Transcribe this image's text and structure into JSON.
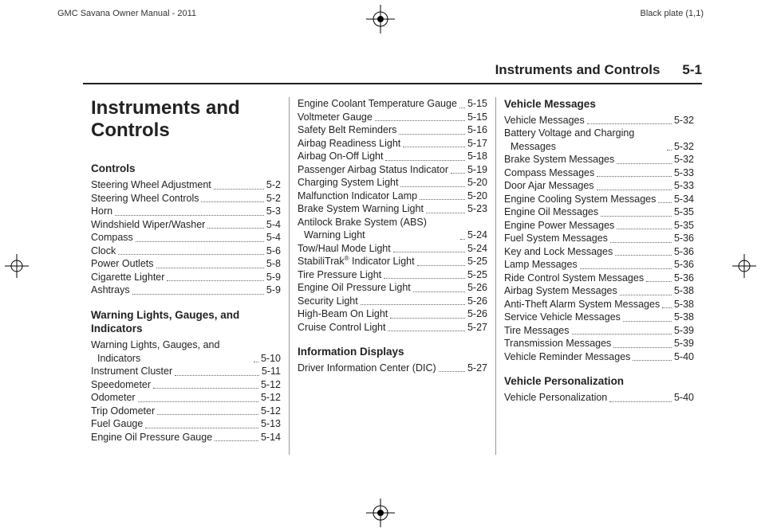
{
  "header": {
    "left": "GMC Savana Owner Manual - 2011",
    "right": "Black plate (1,1)"
  },
  "runningHead": {
    "title": "Instruments and Controls",
    "pageNo": "5-1"
  },
  "chapterTitle": "Instruments and Controls",
  "sections": {
    "controls": {
      "heading": "Controls",
      "items": [
        {
          "label": "Steering Wheel Adjustment",
          "page": "5-2"
        },
        {
          "label": "Steering Wheel Controls",
          "page": "5-2"
        },
        {
          "label": "Horn",
          "page": "5-3"
        },
        {
          "label": "Windshield Wiper/Washer",
          "page": "5-4"
        },
        {
          "label": "Compass",
          "page": "5-4"
        },
        {
          "label": "Clock",
          "page": "5-6"
        },
        {
          "label": "Power Outlets",
          "page": "5-8"
        },
        {
          "label": "Cigarette Lighter",
          "page": "5-9"
        },
        {
          "label": "Ashtrays",
          "page": "5-9"
        }
      ]
    },
    "warning": {
      "heading": "Warning Lights, Gauges, and Indicators",
      "items": [
        {
          "label": "Warning Lights, Gauges, and Indicators",
          "page": "5-10"
        },
        {
          "label": "Instrument Cluster",
          "page": "5-11"
        },
        {
          "label": "Speedometer",
          "page": "5-12"
        },
        {
          "label": "Odometer",
          "page": "5-12"
        },
        {
          "label": "Trip Odometer",
          "page": "5-12"
        },
        {
          "label": "Fuel Gauge",
          "page": "5-13"
        },
        {
          "label": "Engine Oil Pressure Gauge",
          "page": "5-14"
        },
        {
          "label": "Engine Coolant Temperature Gauge",
          "page": "5-15"
        },
        {
          "label": "Voltmeter Gauge",
          "page": "5-15"
        },
        {
          "label": "Safety Belt Reminders",
          "page": "5-16"
        },
        {
          "label": "Airbag Readiness Light",
          "page": "5-17"
        },
        {
          "label": "Airbag On-Off Light",
          "page": "5-18"
        },
        {
          "label": "Passenger Airbag Status Indicator",
          "page": "5-19"
        },
        {
          "label": "Charging System Light",
          "page": "5-20"
        },
        {
          "label": "Malfunction Indicator Lamp",
          "page": "5-20"
        },
        {
          "label": "Brake System Warning Light",
          "page": "5-23"
        },
        {
          "label": "Antilock Brake System (ABS) Warning Light",
          "page": "5-24"
        },
        {
          "label": "Tow/Haul Mode Light",
          "page": "5-24"
        },
        {
          "label": "StabiliTrak® Indicator Light",
          "page": "5-25",
          "reg": true
        },
        {
          "label": "Tire Pressure Light",
          "page": "5-25"
        },
        {
          "label": "Engine Oil Pressure Light",
          "page": "5-26"
        },
        {
          "label": "Security Light",
          "page": "5-26"
        },
        {
          "label": "High-Beam On Light",
          "page": "5-26"
        },
        {
          "label": "Cruise Control Light",
          "page": "5-27"
        }
      ]
    },
    "info": {
      "heading": "Information Displays",
      "items": [
        {
          "label": "Driver Information Center (DIC)",
          "page": "5-27"
        }
      ]
    },
    "vmsg": {
      "heading": "Vehicle Messages",
      "items": [
        {
          "label": "Vehicle Messages",
          "page": "5-32"
        },
        {
          "label": "Battery Voltage and Charging Messages",
          "page": "5-32"
        },
        {
          "label": "Brake System Messages",
          "page": "5-32"
        },
        {
          "label": "Compass Messages",
          "page": "5-33"
        },
        {
          "label": "Door Ajar Messages",
          "page": "5-33"
        },
        {
          "label": "Engine Cooling System Messages",
          "page": "5-34"
        },
        {
          "label": "Engine Oil Messages",
          "page": "5-35"
        },
        {
          "label": "Engine Power Messages",
          "page": "5-35"
        },
        {
          "label": "Fuel System Messages",
          "page": "5-36"
        },
        {
          "label": "Key and Lock Messages",
          "page": "5-36"
        },
        {
          "label": "Lamp Messages",
          "page": "5-36"
        },
        {
          "label": "Ride Control System Messages",
          "page": "5-36"
        },
        {
          "label": "Airbag System Messages",
          "page": "5-38"
        },
        {
          "label": "Anti-Theft Alarm System Messages",
          "page": "5-38"
        },
        {
          "label": "Service Vehicle Messages",
          "page": "5-38"
        },
        {
          "label": "Tire Messages",
          "page": "5-39"
        },
        {
          "label": "Transmission Messages",
          "page": "5-39"
        },
        {
          "label": "Vehicle Reminder Messages",
          "page": "5-40"
        }
      ]
    },
    "vpers": {
      "heading": "Vehicle Personalization",
      "items": [
        {
          "label": "Vehicle Personalization",
          "page": "5-40"
        }
      ]
    }
  }
}
